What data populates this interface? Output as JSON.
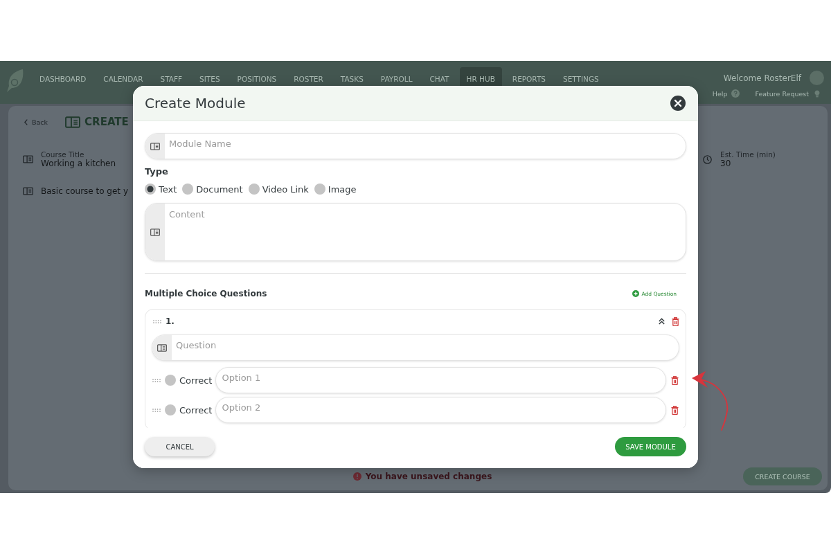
{
  "nav": {
    "items": [
      {
        "label": "DASHBOARD",
        "selected": false
      },
      {
        "label": "CALENDAR",
        "selected": false
      },
      {
        "label": "STAFF",
        "selected": false
      },
      {
        "label": "SITES",
        "selected": false
      },
      {
        "label": "POSITIONS",
        "selected": false
      },
      {
        "label": "ROSTER",
        "selected": false
      },
      {
        "label": "TASKS",
        "selected": false
      },
      {
        "label": "PAYROLL",
        "selected": false
      },
      {
        "label": "CHAT",
        "selected": false
      },
      {
        "label": "HR HUB",
        "selected": true
      },
      {
        "label": "REPORTS",
        "selected": false
      },
      {
        "label": "SETTINGS",
        "selected": false
      }
    ],
    "welcome": "Welcome RosterElf",
    "help": "Help",
    "feature_request": "Feature Request"
  },
  "page": {
    "back": "Back",
    "title": "CREATE",
    "course_title": {
      "label": "Course Title",
      "value": "Working a kitchen"
    },
    "description": "Basic course to get y",
    "est_time": {
      "label": "Est. Time (min)",
      "value": "30"
    },
    "unsaved_notice": "You have unsaved changes",
    "create_button": "CREATE COURSE"
  },
  "modal": {
    "title": "Create Module",
    "module_name": {
      "placeholder": "Module Name"
    },
    "type_label": "Type",
    "types": [
      {
        "label": "Text",
        "selected": true
      },
      {
        "label": "Document",
        "selected": false
      },
      {
        "label": "Video Link",
        "selected": false
      },
      {
        "label": "Image",
        "selected": false
      }
    ],
    "content": {
      "placeholder": "Content"
    },
    "questions_heading": "Multiple Choice Questions",
    "add_question": "Add Question",
    "questions": [
      {
        "number": "1.",
        "expanded": true,
        "question": {
          "placeholder": "Question"
        },
        "options": [
          {
            "label": "Correct",
            "correct": false,
            "placeholder": "Option 1"
          },
          {
            "label": "Correct",
            "correct": false,
            "placeholder": "Option 2"
          }
        ]
      }
    ],
    "cancel_button": "CANCEL",
    "save_button": "SAVE MODULE"
  }
}
